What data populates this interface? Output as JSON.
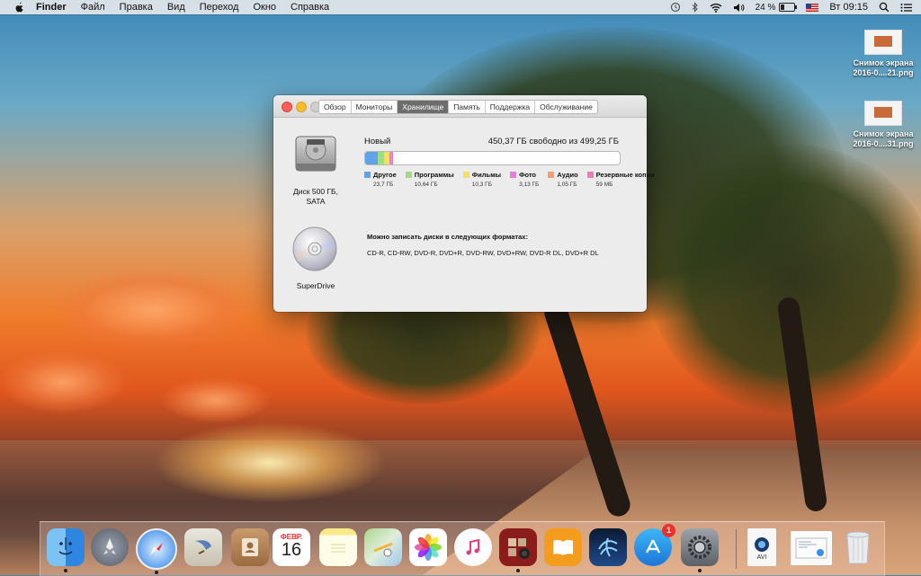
{
  "menubar": {
    "app": "Finder",
    "items": [
      "Файл",
      "Правка",
      "Вид",
      "Переход",
      "Окно",
      "Справка"
    ],
    "battery": "24 %",
    "clock": "Вт 09:15"
  },
  "desktop_files": [
    {
      "line1": "Снимок экрана",
      "line2": "2016-0....21.png"
    },
    {
      "line1": "Снимок экрана",
      "line2": "2016-0....31.png"
    }
  ],
  "window": {
    "tabs": [
      "Обзор",
      "Мониторы",
      "Хранилище",
      "Память",
      "Поддержка",
      "Обслуживание"
    ],
    "active_tab": "Хранилище",
    "disk_label_1": "Диск 500 ГБ,",
    "disk_label_2": "SATA",
    "volume_name": "Новый",
    "free_text": "450,37 ГБ свободно из 499,25 ГБ",
    "legend": [
      {
        "label": "Другое",
        "size": "23,7 ГБ",
        "color": "#5fa4e8"
      },
      {
        "label": "Программы",
        "size": "10,64 ГБ",
        "color": "#9fdc82"
      },
      {
        "label": "Фильмы",
        "size": "10,3 ГБ",
        "color": "#f6df63"
      },
      {
        "label": "Фото",
        "size": "3,13 ГБ",
        "color": "#ea7ae0"
      },
      {
        "label": "Аудио",
        "size": "1,05 ГБ",
        "color": "#f59f6e"
      },
      {
        "label": "Резервные копии",
        "size": "59 МБ",
        "color": "#f07ab8"
      }
    ],
    "superdrive_label": "SuperDrive",
    "burn_title": "Можно записать диски в следующих форматах:",
    "burn_formats": "CD-R, CD-RW, DVD-R, DVD+R, DVD-RW, DVD+RW, DVD-R DL, DVD+R DL"
  },
  "dock": {
    "calendar_month": "ФЕВР.",
    "calendar_day": "16",
    "appstore_badge": "1",
    "avi_label": "AVI"
  }
}
